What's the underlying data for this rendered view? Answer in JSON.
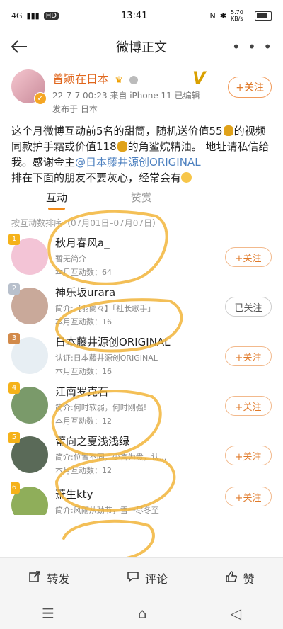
{
  "status": {
    "signal": "4G",
    "hd": "HD",
    "time": "13:41",
    "nfc": "N",
    "bt": "✱",
    "speed": "5.70 KB/s"
  },
  "nav": {
    "title": "微博正文",
    "back_icon": "arrow-left-icon",
    "more_icon": "ellipsis-icon"
  },
  "post": {
    "username": "曾颖在日本",
    "date_line": "22-7-7 00:23  来自 iPhone 11  已编辑",
    "location": "发布于 日本",
    "follow_label": "+关注",
    "vip_mark": "V",
    "text_parts": [
      "这个月微博互动前5名的甜筒，随机送价值55",
      "的视频同款护手霜或价值118",
      "的角鲨烷精油。 地址请私信给我。感谢金主",
      "@日本藤井源创ORIGINAL",
      "排在下面的朋友不要灰心，经常会有"
    ]
  },
  "tabs": {
    "active": "互动",
    "inactive": "赞赏"
  },
  "sort_text": "按互动数排序（07月01日–07月07日）",
  "list": [
    {
      "name": "秋月春风a_",
      "desc": "暂无简介",
      "count": "本月互动数：64",
      "button": "+关注",
      "followed": false,
      "rank": "1",
      "avatar_color": "#f3c4d6",
      "rank_color": "#f5b21a"
    },
    {
      "name": "神乐坂urara",
      "desc": "简介:【羽蘭々】「社长歌手」",
      "count": "本月互动数：16",
      "button": "已关注",
      "followed": true,
      "rank": "2",
      "avatar_color": "#c9a99a",
      "rank_color": "#b8c0cc"
    },
    {
      "name": "日本藤井源创ORIGINAL",
      "desc": "认证:日本藤井源创ORIGINAL",
      "count": "本月互动数：16",
      "button": "+关注",
      "followed": false,
      "rank": "3",
      "avatar_color": "#e7eef3",
      "rank_color": "#d28a4a"
    },
    {
      "name": "江南罗克石",
      "desc": "简介:何时软弱，何时刚强!",
      "count": "本月互动数：12",
      "button": "+关注",
      "followed": false,
      "rank": "4",
      "avatar_color": "#7a9a6a",
      "rank_color": "#f5b21a"
    },
    {
      "name": "莆向之夏浅浅绿",
      "desc": "简介:位置不同，少言为贵，认...",
      "count": "本月互动数：12",
      "button": "+关注",
      "followed": false,
      "rank": "5",
      "avatar_color": "#5a6a58",
      "rank_color": "#f5b21a"
    },
    {
      "name": "萧生kty",
      "desc": "简介:风雨从劲节，雪一尽冬至",
      "count": "",
      "button": "+关注",
      "followed": false,
      "rank": "6",
      "avatar_color": "#8fae5a",
      "rank_color": "#f5b21a"
    }
  ],
  "bottom": {
    "repost": "转发",
    "comment": "评论",
    "like": "赞"
  },
  "colors": {
    "accent": "#e07a2a",
    "link": "#4b7fbf",
    "highlighter": "#f2b53a"
  }
}
